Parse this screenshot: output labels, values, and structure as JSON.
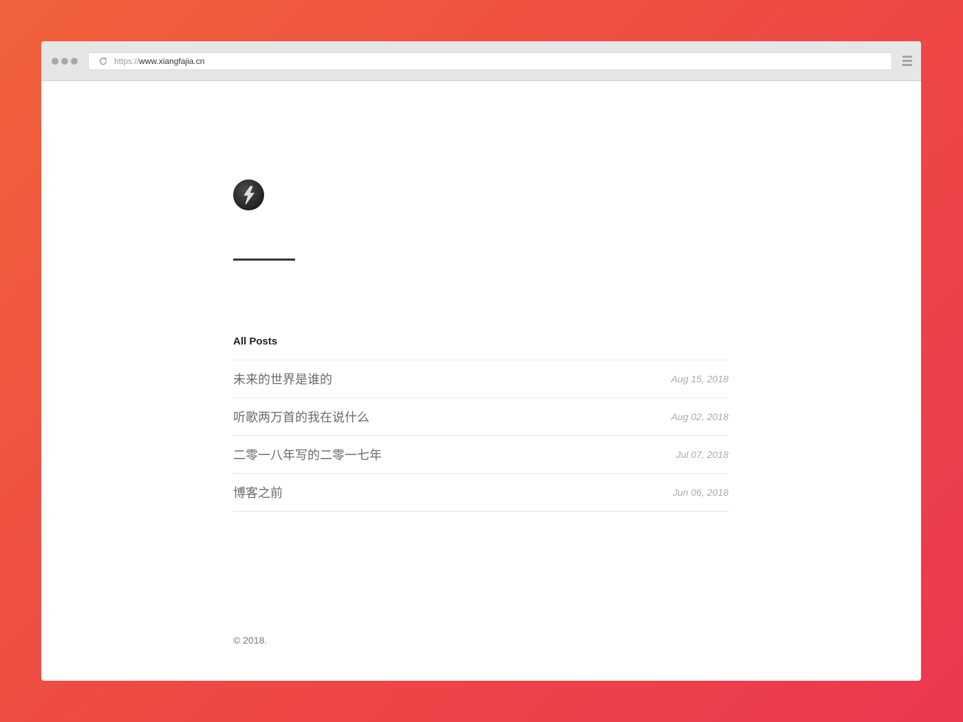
{
  "browser": {
    "url_protocol": "https://",
    "url_host": "www.xiangfajia.cn"
  },
  "icons": {
    "reload": "reload-icon",
    "menu": "hamburger-menu-icon",
    "avatar": "lightning-avatar"
  },
  "colors": {
    "background_gradient_start": "#f0613a",
    "background_gradient_end": "#ec384f",
    "text_primary": "#222222",
    "text_post": "#6b6b6b",
    "text_date": "#aaaaaa"
  },
  "main": {
    "section_title": "All Posts",
    "posts": [
      {
        "title": "未来的世界是谁的",
        "date": "Aug 15, 2018"
      },
      {
        "title": "听歌两万首的我在说什么",
        "date": "Aug 02, 2018"
      },
      {
        "title": "二零一八年写的二零一七年",
        "date": "Jul 07, 2018"
      },
      {
        "title": "博客之前",
        "date": "Jun 06, 2018"
      }
    ]
  },
  "footer": {
    "copyright": "© 2018."
  }
}
